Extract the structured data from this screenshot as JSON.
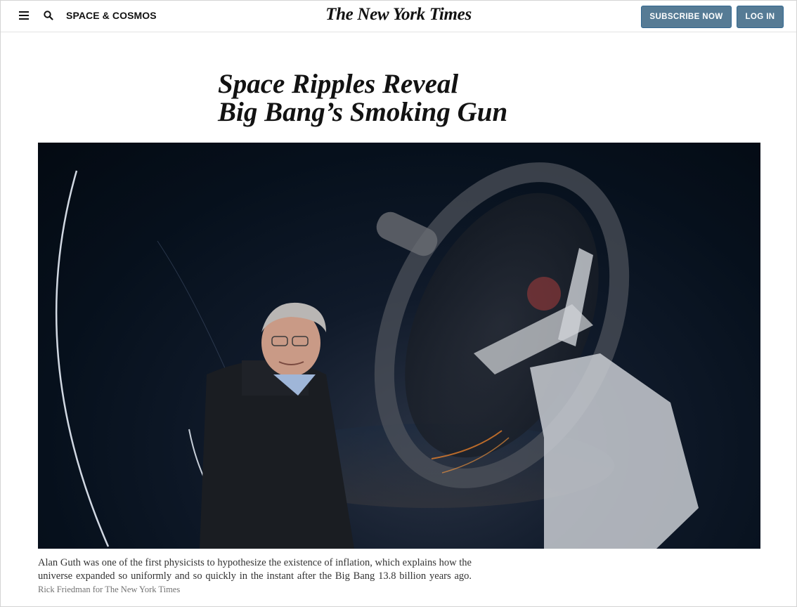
{
  "header": {
    "section": "SPACE & COSMOS",
    "masthead": "The New York Times",
    "subscribe_label": "Subscribe Now",
    "login_label": "Log In",
    "icons": {
      "menu": "hamburger-menu-icon",
      "search": "search-icon"
    },
    "colors": {
      "button_bg": "#567b95",
      "text": "#121212"
    }
  },
  "article": {
    "headline_line1": "Space Ripples Reveal",
    "headline_line2": "Big Bang’s Smoking Gun",
    "photo": {
      "description_name": "lead-photo"
    },
    "caption": "Alan Guth was one of the first physicists to hypothesize the existence of inflation, which explains how the universe expanded so uniformly and so quickly in the instant after the Big Bang 13.8 billion years ago.",
    "credit": "Rick Friedman for The New York Times"
  }
}
